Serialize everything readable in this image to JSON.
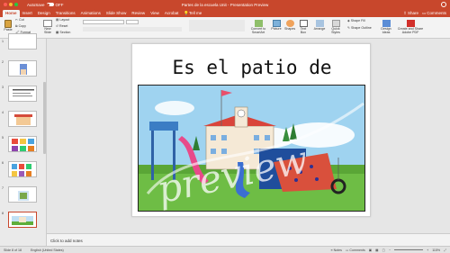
{
  "window": {
    "title": "Partes de la escuela Unit - Presentation Preview",
    "autosave_label": "AutoSave",
    "autosave_state": "OFF"
  },
  "tabs": [
    "Home",
    "Insert",
    "Design",
    "Transitions",
    "Animations",
    "Slide Show",
    "Review",
    "View",
    "Acrobat",
    "Tell me"
  ],
  "active_tab": "Home",
  "tab_actions": {
    "share": "Share",
    "comments": "Comments"
  },
  "ribbon": {
    "paste": "Paste",
    "cut": "Cut",
    "copy": "Copy",
    "format": "Format",
    "new_slide": "New Slide",
    "layout": "Layout",
    "reset": "Reset",
    "section": "Section",
    "convert_smartart": "Convert to SmartArt",
    "picture": "Picture",
    "shapes": "Shapes",
    "text_box": "Text Box",
    "arrange": "Arrange",
    "quick_styles": "Quick Styles",
    "shape_fill": "Shape Fill",
    "shape_outline": "Shape Outline",
    "design_ideas": "Design Ideas",
    "create_share_pdf": "Create and Share Adobe PDF"
  },
  "slides": [
    {
      "num": "1"
    },
    {
      "num": "2"
    },
    {
      "num": "3"
    },
    {
      "num": "4"
    },
    {
      "num": "5"
    },
    {
      "num": "6"
    },
    {
      "num": "7"
    },
    {
      "num": "8"
    }
  ],
  "slide": {
    "title": "Es el patio de recreo.",
    "watermark": "preview"
  },
  "notes_placeholder": "Click to add notes",
  "status": {
    "slide_info": "Slide 8 of 18",
    "language": "English (United States)",
    "notes": "Notes",
    "comments": "Comments",
    "zoom": "115%"
  },
  "colors": {
    "accent": "#c8472c",
    "ribbon": "#f3f3f3",
    "canvas": "#e6e6e6"
  }
}
